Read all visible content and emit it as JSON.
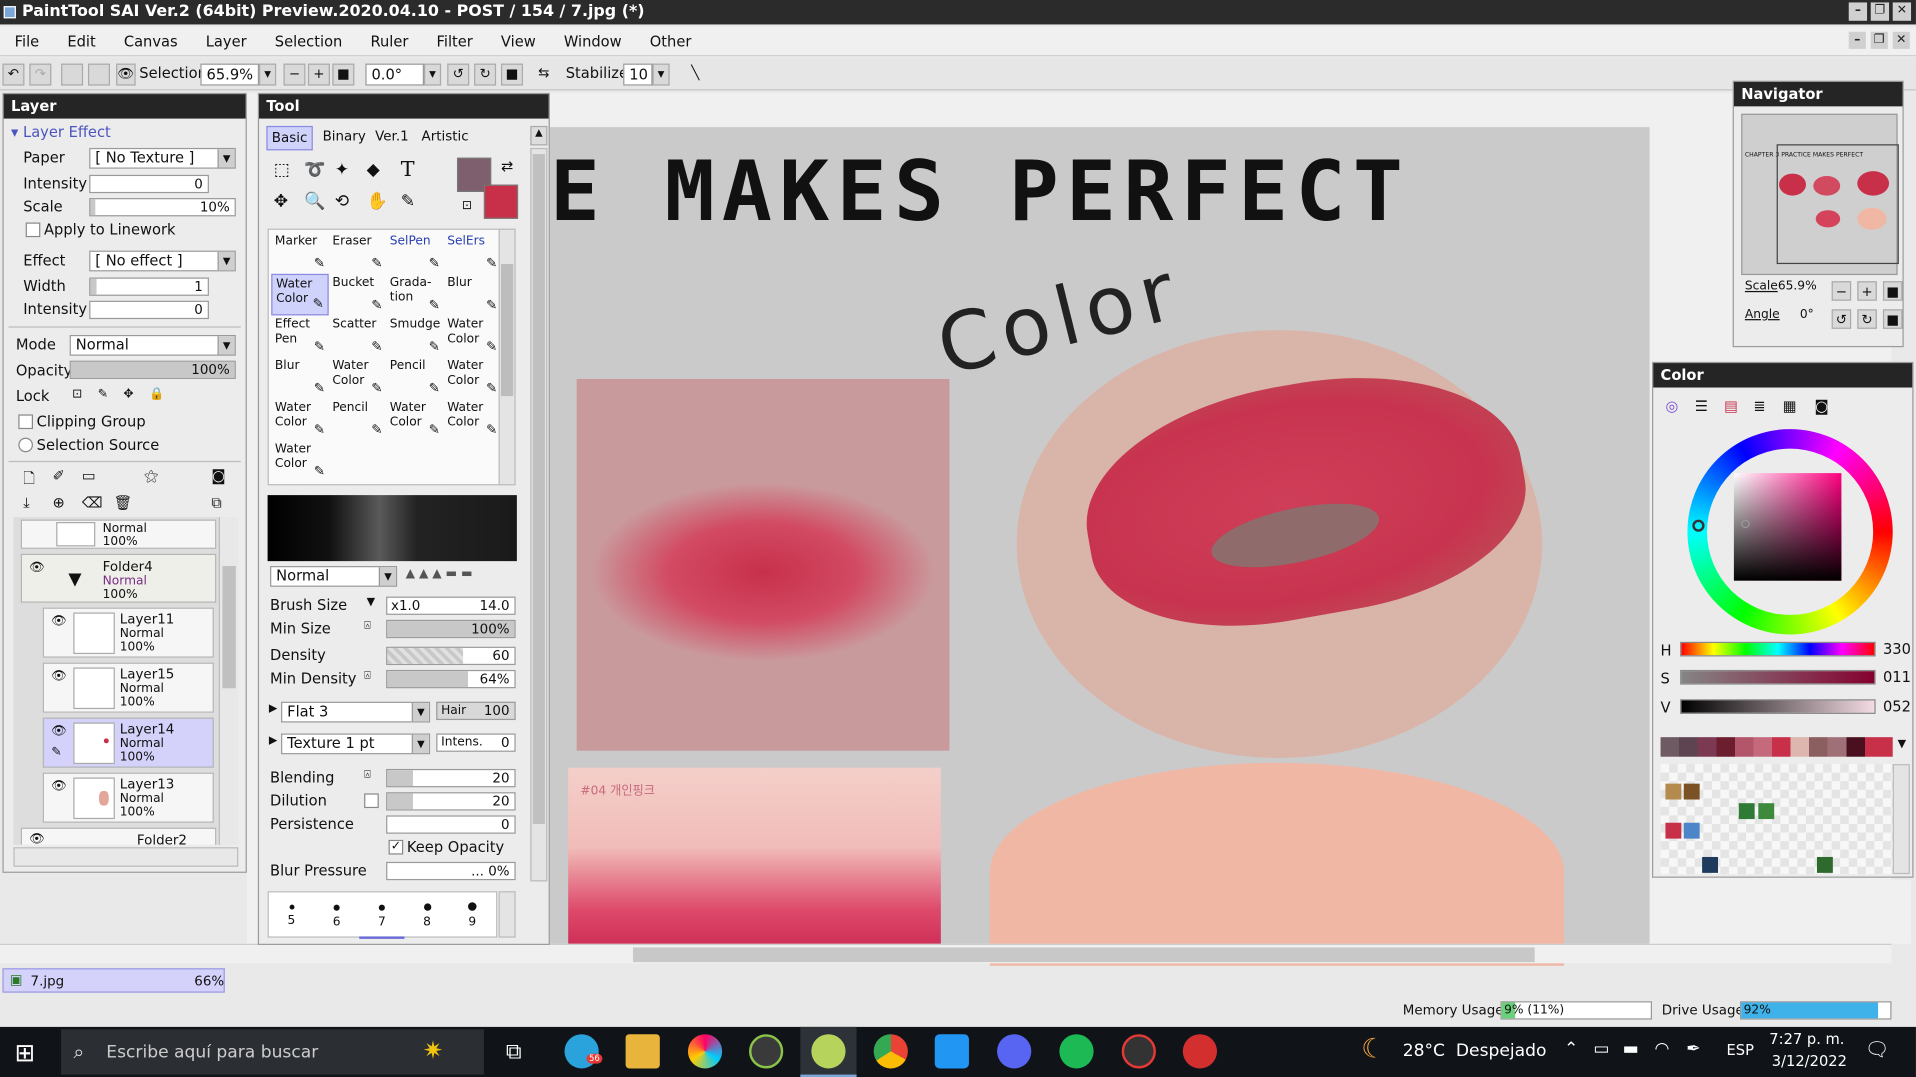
{
  "window": {
    "title": "PaintTool SAI Ver.2 (64bit) Preview.2020.04.10 - POST / 154 / 7.jpg (*)"
  },
  "menu": [
    "File",
    "Edit",
    "Canvas",
    "Layer",
    "Selection",
    "Ruler",
    "Filter",
    "View",
    "Window",
    "Other"
  ],
  "toolbar": {
    "selection_label": "Selection",
    "zoom": "65.9%",
    "angle": "0.0°",
    "stabilizer_label": "Stabilizer",
    "stabilizer_value": "10"
  },
  "layer_panel": {
    "title": "Layer",
    "section": "Layer Effect",
    "paper_label": "Paper",
    "paper_value": "[ No Texture ]",
    "intensity_label": "Intensity",
    "intensity_value": "0",
    "scale_label": "Scale",
    "scale_value": "10%",
    "apply_linework": "Apply to Linework",
    "effect_label": "Effect",
    "effect_value": "[ No effect ]",
    "width_label": "Width",
    "width_value": "1",
    "intensity2_label": "Intensity",
    "intensity2_value": "0",
    "mode_label": "Mode",
    "mode_value": "Normal",
    "opacity_label": "Opacity",
    "opacity_value": "100%",
    "lock_label": "Lock",
    "clipping": "Clipping Group",
    "selection_source": "Selection Source",
    "layers": [
      {
        "name": "",
        "mode": "Normal",
        "opacity": "100%"
      },
      {
        "name": "Folder4",
        "mode": "Normal",
        "opacity": "100%"
      },
      {
        "name": "Layer11",
        "mode": "Normal",
        "opacity": "100%"
      },
      {
        "name": "Layer15",
        "mode": "Normal",
        "opacity": "100%"
      },
      {
        "name": "Layer14",
        "mode": "Normal",
        "opacity": "100%"
      },
      {
        "name": "Layer13",
        "mode": "Normal",
        "opacity": "100%"
      },
      {
        "name": "Folder2"
      }
    ]
  },
  "tool_panel": {
    "title": "Tool",
    "tabs": [
      "Basic",
      "Binary",
      "Ver.1",
      "Artistic"
    ],
    "brushes": [
      "Marker",
      "Eraser",
      "SelPen",
      "SelErs",
      "Water Color",
      "Bucket",
      "Grada-tion",
      "Blur",
      "Effect Pen",
      "Scatter",
      "Smudge",
      "Water Color",
      "Blur",
      "Water Color",
      "Pencil",
      "Water Color",
      "Water Color",
      "Pencil",
      "Water Color",
      "Water Color",
      "Water Color"
    ],
    "blend_mode": "Normal",
    "brush_size_label": "Brush Size",
    "brush_size_mult": "x1.0",
    "brush_size_value": "14.0",
    "min_size_label": "Min Size",
    "min_size_value": "100%",
    "density_label": "Density",
    "density_value": "60",
    "min_density_label": "Min Density",
    "min_density_value": "64%",
    "shape": "Flat 3",
    "hair_label": "Hair",
    "hair_value": "100",
    "texture": "Texture 1 pt",
    "intens_label": "Intens.",
    "intens_value": "0",
    "blending_label": "Blending",
    "blending_value": "20",
    "dilution_label": "Dilution",
    "dilution_value": "20",
    "persistence_label": "Persistence",
    "persistence_value": "0",
    "keep_opacity": "Keep Opacity",
    "blur_pressure_label": "Blur Pressure",
    "blur_pressure_value": "... 0%",
    "dot_sizes": [
      "5",
      "6",
      "7",
      "8",
      "9"
    ]
  },
  "canvas": {
    "heading": "E MAKES PERFECT",
    "script": "Color",
    "ref_label": "#04 개인핑크"
  },
  "navigator": {
    "title": "Navigator",
    "scale_label": "Scale",
    "scale_value": "65.9%",
    "angle_label": "Angle",
    "angle_value": "0°",
    "thumb_caption": "CHAPTER 3 PRACTICE MAKES PERFECT"
  },
  "color_panel": {
    "title": "Color",
    "h_label": "H",
    "h_value": "330",
    "s_label": "S",
    "s_value": "011",
    "v_label": "V",
    "v_value": "052",
    "main_color": "#c8304a",
    "secondary_color": "#7e5f6d"
  },
  "statusbar": {
    "file": "7.jpg",
    "zoom": "66%",
    "memory_label": "Memory Usage",
    "memory_value": "9% (11%)",
    "memory_fill_pct": 9,
    "drive_label": "Drive Usage",
    "drive_value": "92%",
    "drive_fill_pct": 92
  },
  "taskbar": {
    "search_placeholder": "Escribe aquí para buscar",
    "weather": "28°C  Despejado",
    "lang": "ESP",
    "time": "7:27 p. m.",
    "date": "3/12/2022",
    "badge": "56"
  }
}
